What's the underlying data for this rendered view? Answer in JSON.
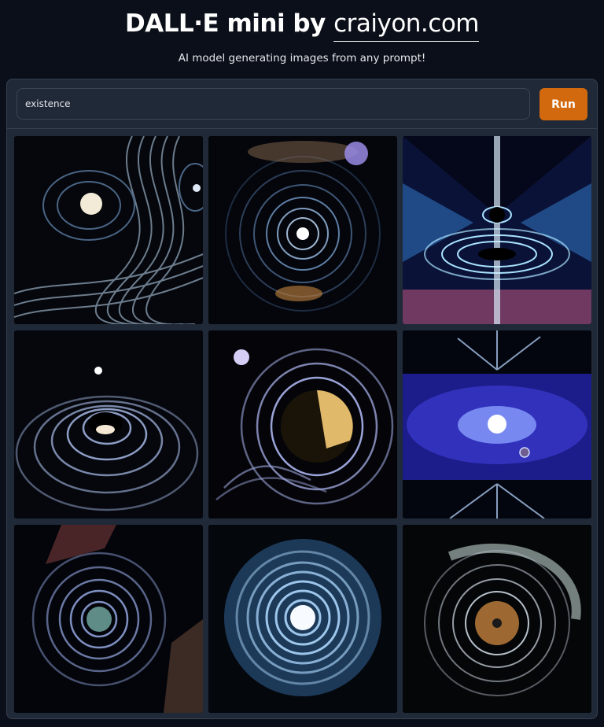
{
  "header": {
    "title_prefix": "DALL·E mini by",
    "title_link": "craiyon.com",
    "subtitle": "AI model generating images from any prompt!"
  },
  "prompt": {
    "value": "existence"
  },
  "run_label": "Run",
  "gallery": [
    {
      "name": "generated-image-1"
    },
    {
      "name": "generated-image-2"
    },
    {
      "name": "generated-image-3"
    },
    {
      "name": "generated-image-4"
    },
    {
      "name": "generated-image-5"
    },
    {
      "name": "generated-image-6"
    },
    {
      "name": "generated-image-7"
    },
    {
      "name": "generated-image-8"
    },
    {
      "name": "generated-image-9"
    }
  ],
  "colors": {
    "background": "#0b0f19",
    "panel": "#1f2937",
    "accent": "#d2690e"
  }
}
